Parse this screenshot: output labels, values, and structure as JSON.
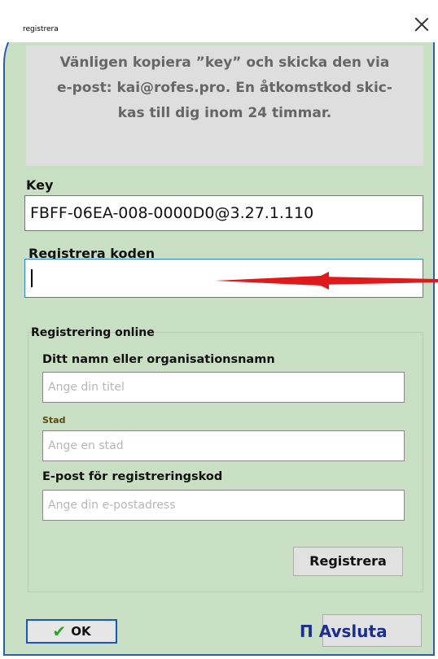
{
  "window": {
    "title": "registrera"
  },
  "info": {
    "lines": [
      "Vänligen kopiera ”key” och skicka den via",
      "e-post: kai@rofes.pro. En åtkomstkod skic-",
      "kas till dig inom 24 timmar."
    ]
  },
  "key": {
    "label": "Key",
    "value": "FBFF-06EA-008-0000D0@3.27.1.110"
  },
  "register_code": {
    "label": "Registrera koden",
    "value": ""
  },
  "online": {
    "title": "Registrering online",
    "name_label": "Ditt namn eller organisationsnamn",
    "name_placeholder": "Ange din titel",
    "city_label": "Stad",
    "city_placeholder": "Ange en stad",
    "email_label": "E-post för registreringskod",
    "email_placeholder": "Ange din e-postadress"
  },
  "buttons": {
    "register": "Registrera",
    "ok": "OK",
    "quit": "Π Avsluta"
  },
  "colors": {
    "background": "#c9dfc3",
    "border": "#2f5ea8",
    "arrow": "#e01a1a"
  }
}
